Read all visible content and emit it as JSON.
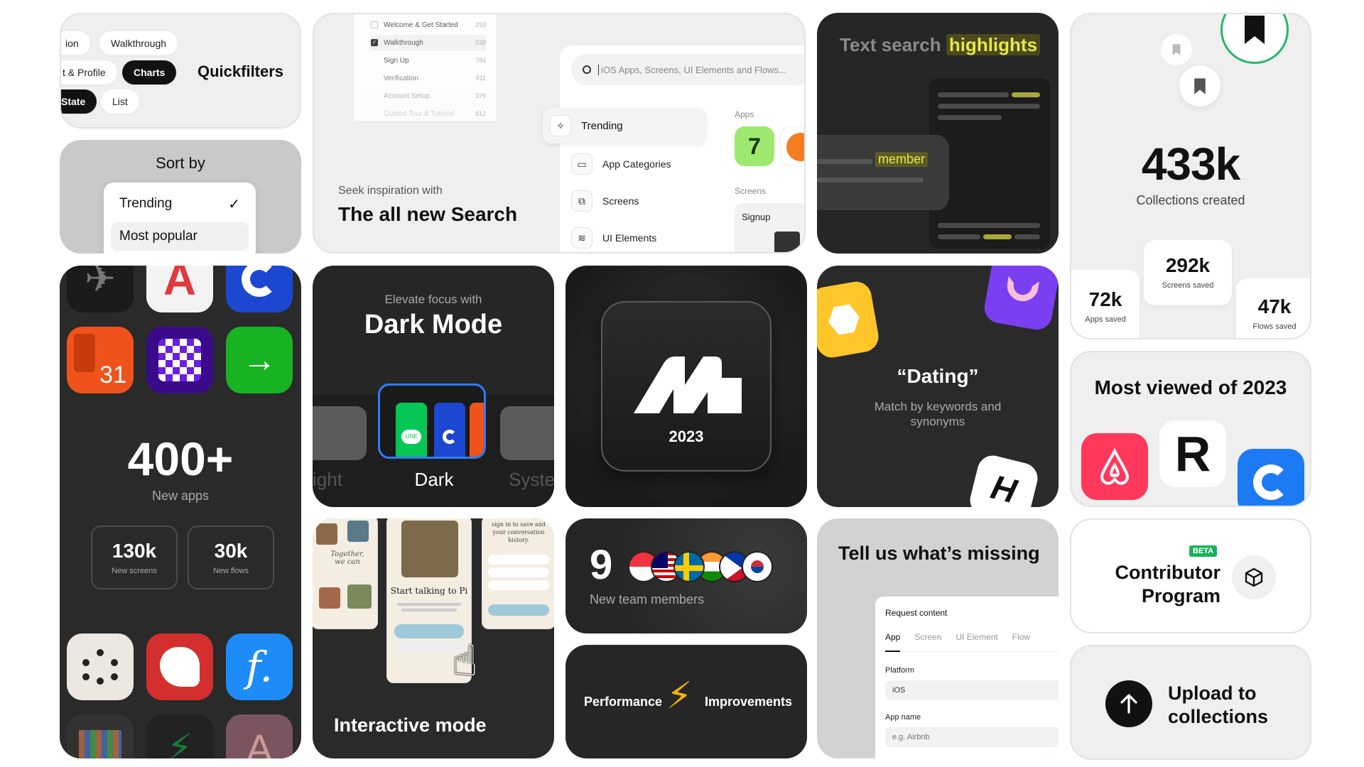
{
  "quickfilters": {
    "title": "Quickfilters",
    "pills": [
      "ion",
      "Walkthrough",
      "t & Profile",
      "Charts",
      "State",
      "List"
    ]
  },
  "sort_by": {
    "title": "Sort by",
    "options": [
      "Trending",
      "Most popular"
    ],
    "selected": "Trending"
  },
  "search": {
    "task_flows": [
      {
        "label": "Welcome & Get Started",
        "count": "293",
        "checked": false
      },
      {
        "label": "Walkthrough",
        "count": "538",
        "checked": true
      },
      {
        "label": "Sign Up",
        "count": "784",
        "checked": false
      },
      {
        "label": "Verification",
        "count": "911",
        "checked": false
      },
      {
        "label": "Account Setup",
        "count": "376",
        "checked": false
      },
      {
        "label": "Guided Tour & Tutorial",
        "count": "412",
        "checked": false
      }
    ],
    "placeholder": "iOS Apps, Screens, UI Elements and Flows...",
    "menu": [
      "Trending",
      "App Categories",
      "Screens",
      "UI Elements"
    ],
    "apps_label": "Apps",
    "screens_label": "Screens",
    "screen_card_label": "Signup",
    "tagline": "Seek inspiration with",
    "headline": "The all new Search"
  },
  "text_search": {
    "title_plain": "Text search",
    "title_highlight": "highlights",
    "keyword": "member"
  },
  "collections": {
    "big_value": "433k",
    "big_label": "Collections created",
    "stats": [
      {
        "value": "72k",
        "label": "Apps saved"
      },
      {
        "value": "292k",
        "label": "Screens saved"
      },
      {
        "value": "47k",
        "label": "Flows saved"
      }
    ]
  },
  "new_apps": {
    "big_value": "400+",
    "big_label": "New apps",
    "stats": [
      {
        "value": "130k",
        "label": "New screens"
      },
      {
        "value": "30k",
        "label": "New flows"
      }
    ],
    "calendar_day": "31"
  },
  "dark_mode": {
    "subtitle": "Elevate focus with",
    "title": "Dark Mode",
    "options": [
      "ight",
      "Dark",
      "Syste"
    ]
  },
  "logo_card": {
    "year": "2023"
  },
  "dating": {
    "title": "“Dating”",
    "subtitle": "Match by keywords and synonyms"
  },
  "most_viewed": {
    "title": "Most viewed of 2023"
  },
  "interactive": {
    "title": "Interactive mode",
    "phone_texts": [
      "Together, we can",
      "Start talking to Pi",
      "sign in to save and your conversation history."
    ]
  },
  "team": {
    "count": "9",
    "label": "New team members"
  },
  "performance": {
    "left": "Performance",
    "right": "Improvements"
  },
  "missing": {
    "title": "Tell us what’s missing",
    "form_title": "Request content",
    "tabs": [
      "App",
      "Screen",
      "UI Element",
      "Flow"
    ],
    "active_tab": "App",
    "platform_label": "Platform",
    "platform_value": "iOS",
    "app_name_label": "App name",
    "app_name_placeholder": "e.g. Airbnb"
  },
  "contributor": {
    "badge": "BETA",
    "title": "Contributor Program"
  },
  "upload": {
    "title": "Upload to collections"
  },
  "colors": {
    "highlight": "#e8e84a",
    "accent_blue": "#2f7cf6",
    "badge_green": "#19b35a",
    "ring_green": "#22b869"
  }
}
